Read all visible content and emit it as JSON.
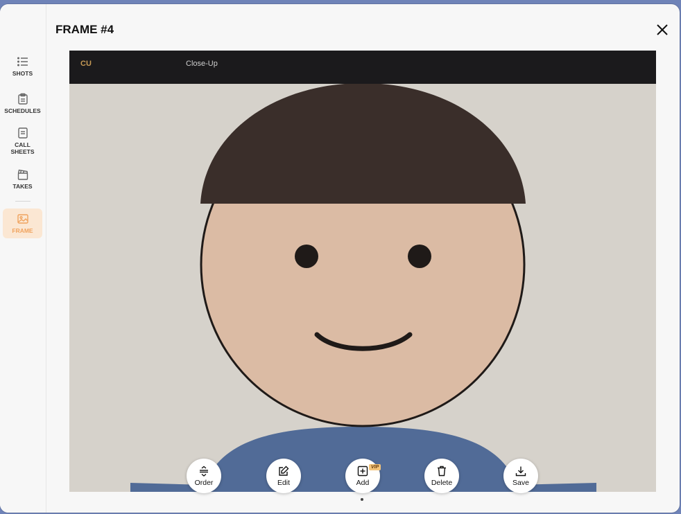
{
  "window": {
    "title": "FRAME #4"
  },
  "sidebar": {
    "items": [
      {
        "label": "SHOTS",
        "icon": "list-icon"
      },
      {
        "label": "SCHEDULES",
        "icon": "clipboard-icon"
      },
      {
        "label": "CALL\nSHEETS",
        "icon": "document-icon"
      },
      {
        "label": "TAKES",
        "icon": "clapperboard-icon"
      },
      {
        "label": "FRAME",
        "icon": "image-icon",
        "active": true
      }
    ]
  },
  "frame": {
    "shot_code": "CU",
    "shot_description": "Close-Up"
  },
  "actions": {
    "order_label": "Order",
    "edit_label": "Edit",
    "add_label": "Add",
    "add_badge": "VIP",
    "delete_label": "Delete",
    "save_label": "Save"
  },
  "colors": {
    "accent": "#f0a35e",
    "header_bg": "#1b1a1c",
    "shot_code": "#c69a55",
    "canvas_bg": "#d6d2cb",
    "hair": "#3a2e2a",
    "skin": "#dbbba4",
    "shirt": "#516b97"
  }
}
